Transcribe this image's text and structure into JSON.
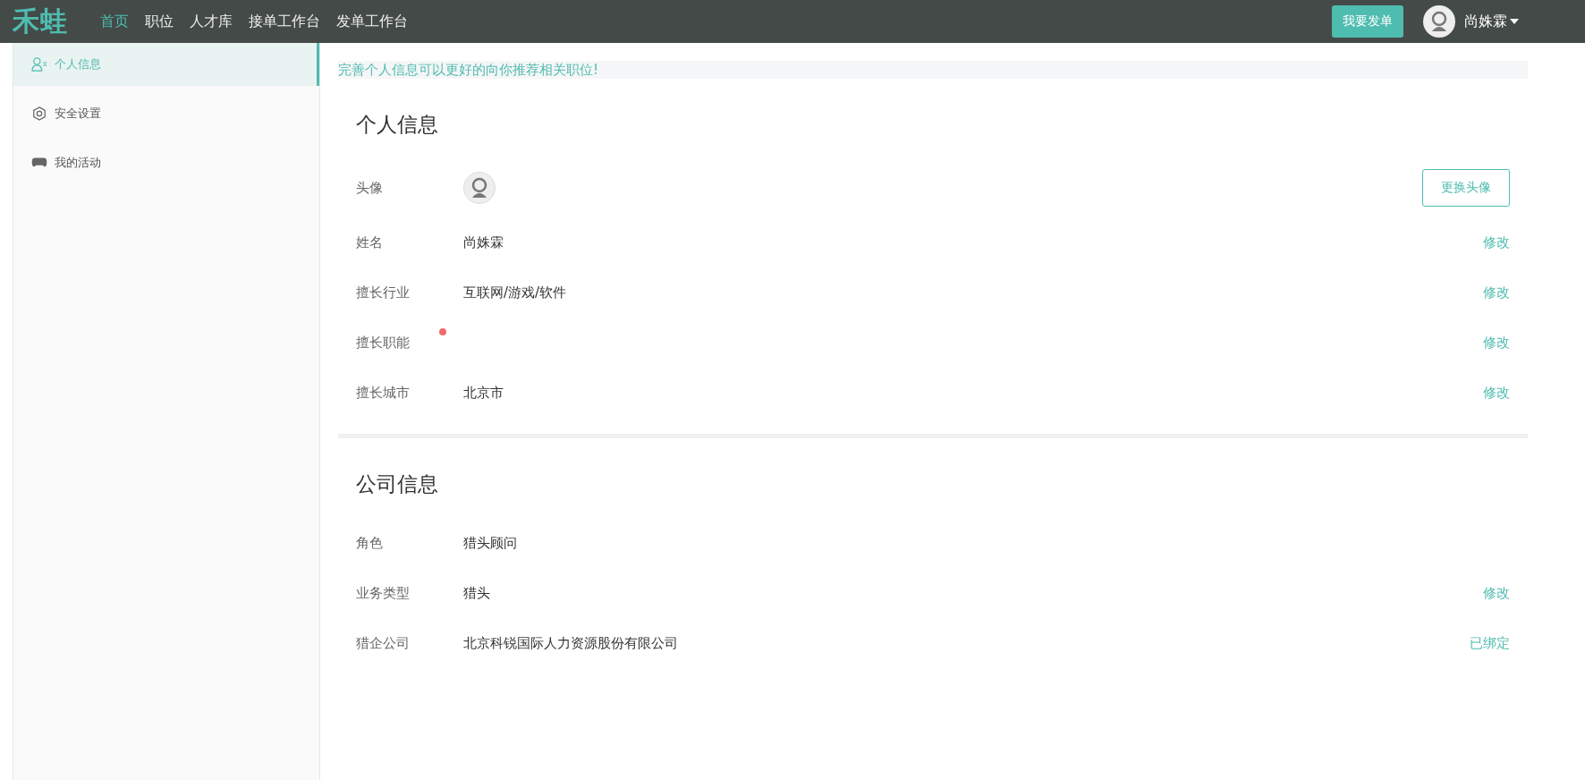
{
  "header": {
    "logo": "禾蛙",
    "nav": [
      {
        "label": "首页",
        "selected": true
      },
      {
        "label": "职位",
        "selected": false
      },
      {
        "label": "人才库",
        "selected": false
      },
      {
        "label": "接单工作台",
        "selected": false
      },
      {
        "label": "发单工作台",
        "selected": false
      }
    ],
    "post_button": "我要发单",
    "user_name": "尚姝霖"
  },
  "sidebar": {
    "items": [
      {
        "label": "个人信息",
        "selected": true
      },
      {
        "label": "安全设置",
        "selected": false
      },
      {
        "label": "我的活动",
        "selected": false
      }
    ]
  },
  "notice": "完善个人信息可以更好的向你推荐相关职位!",
  "sections": [
    {
      "title": "个人信息",
      "rows": [
        {
          "kind": "avatar",
          "label": "头像",
          "action": "更换头像",
          "alert": false
        },
        {
          "kind": "text",
          "label": "姓名",
          "value": "尚姝霖",
          "action": "修改",
          "alert": false
        },
        {
          "kind": "text",
          "label": "擅长行业",
          "value": "互联网/游戏/软件",
          "action": "修改",
          "alert": false
        },
        {
          "kind": "text",
          "label": "擅长职能",
          "action": "修改",
          "alert": true
        },
        {
          "kind": "text",
          "label": "擅长城市",
          "value": "北京市",
          "action": "修改",
          "alert": false
        }
      ]
    },
    {
      "title": "公司信息",
      "rows": [
        {
          "kind": "text",
          "label": "角色",
          "value": "猎头顾问",
          "alert": false
        },
        {
          "kind": "text",
          "label": "业务类型",
          "value": "猎头",
          "action": "修改",
          "alert": false
        },
        {
          "kind": "text",
          "label": "猎企公司",
          "value": "北京科锐国际人力资源股份有限公司",
          "action": "已绑定",
          "alert": false
        }
      ]
    }
  ]
}
